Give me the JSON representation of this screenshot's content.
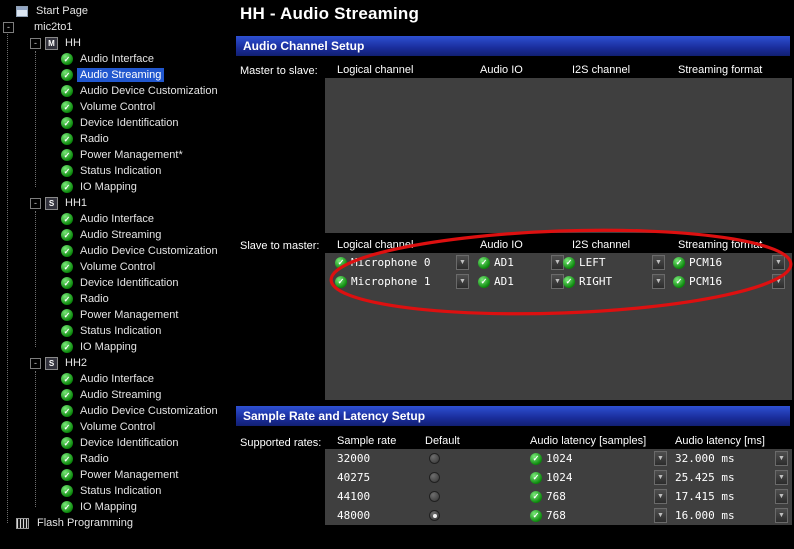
{
  "annotation": {
    "color": "#dd1010"
  },
  "colors": {
    "section_header_blue": "#1b2fa0",
    "table_body_gray": "#3f3f3f",
    "check_green": "#0d8a0d",
    "selection_blue": "#2157ce",
    "annotation_red": "#dd1010"
  },
  "sidebar": {
    "items": [
      {
        "label": "Start Page",
        "level": 0,
        "icon": "page"
      },
      {
        "label": "mic2to1",
        "level": 0,
        "expander": true
      },
      {
        "label": "HH",
        "level": 1,
        "expander": true,
        "badge": "M"
      },
      {
        "label": "Audio Interface",
        "level": 2,
        "icon": "check"
      },
      {
        "label": "Audio Streaming",
        "level": 2,
        "icon": "check",
        "selected": true
      },
      {
        "label": "Audio Device Customization",
        "level": 2,
        "icon": "check"
      },
      {
        "label": "Volume Control",
        "level": 2,
        "icon": "check"
      },
      {
        "label": "Device Identification",
        "level": 2,
        "icon": "check"
      },
      {
        "label": "Radio",
        "level": 2,
        "icon": "check"
      },
      {
        "label": "Power Management*",
        "level": 2,
        "icon": "check"
      },
      {
        "label": "Status Indication",
        "level": 2,
        "icon": "check"
      },
      {
        "label": "IO Mapping",
        "level": 2,
        "icon": "check"
      },
      {
        "label": "HH1",
        "level": 1,
        "expander": true,
        "badge": "S"
      },
      {
        "label": "Audio Interface",
        "level": 2,
        "icon": "check"
      },
      {
        "label": "Audio Streaming",
        "level": 2,
        "icon": "check"
      },
      {
        "label": "Audio Device Customization",
        "level": 2,
        "icon": "check"
      },
      {
        "label": "Volume Control",
        "level": 2,
        "icon": "check"
      },
      {
        "label": "Device Identification",
        "level": 2,
        "icon": "check"
      },
      {
        "label": "Radio",
        "level": 2,
        "icon": "check"
      },
      {
        "label": "Power Management",
        "level": 2,
        "icon": "check"
      },
      {
        "label": "Status Indication",
        "level": 2,
        "icon": "check"
      },
      {
        "label": "IO Mapping",
        "level": 2,
        "icon": "check"
      },
      {
        "label": "HH2",
        "level": 1,
        "expander": true,
        "badge": "S"
      },
      {
        "label": "Audio Interface",
        "level": 2,
        "icon": "check"
      },
      {
        "label": "Audio Streaming",
        "level": 2,
        "icon": "check"
      },
      {
        "label": "Audio Device Customization",
        "level": 2,
        "icon": "check"
      },
      {
        "label": "Volume Control",
        "level": 2,
        "icon": "check"
      },
      {
        "label": "Device Identification",
        "level": 2,
        "icon": "check"
      },
      {
        "label": "Radio",
        "level": 2,
        "icon": "check"
      },
      {
        "label": "Power Management",
        "level": 2,
        "icon": "check"
      },
      {
        "label": "Status Indication",
        "level": 2,
        "icon": "check"
      },
      {
        "label": "IO Mapping",
        "level": 2,
        "icon": "check"
      },
      {
        "label": "Flash Programming",
        "level": 0,
        "icon": "flash"
      }
    ]
  },
  "main": {
    "title": "HH - Audio Streaming",
    "audio_channel_setup": {
      "header": "Audio Channel Setup",
      "master_label": "Master to slave:",
      "slave_label": "Slave to master:",
      "columns": [
        "Logical channel",
        "Audio IO",
        "I2S channel",
        "Streaming format"
      ],
      "master_rows": [],
      "slave_rows": [
        {
          "logical": "Microphone 0",
          "audio_io": "AD1",
          "i2s": "LEFT",
          "format": "PCM16"
        },
        {
          "logical": "Microphone 1",
          "audio_io": "AD1",
          "i2s": "RIGHT",
          "format": "PCM16"
        }
      ]
    },
    "sample_rate_setup": {
      "header": "Sample Rate and Latency Setup",
      "label": "Supported rates:",
      "columns": [
        "Sample rate",
        "Default",
        "Audio latency [samples]",
        "Audio latency [ms]"
      ],
      "rows": [
        {
          "rate": "32000",
          "default": false,
          "latency_samples": "1024",
          "latency_ms": "32.000 ms"
        },
        {
          "rate": "40275",
          "default": false,
          "latency_samples": "1024",
          "latency_ms": "25.425 ms"
        },
        {
          "rate": "44100",
          "default": false,
          "latency_samples": "768",
          "latency_ms": "17.415 ms"
        },
        {
          "rate": "48000",
          "default": true,
          "latency_samples": "768",
          "latency_ms": "16.000 ms"
        }
      ]
    }
  }
}
